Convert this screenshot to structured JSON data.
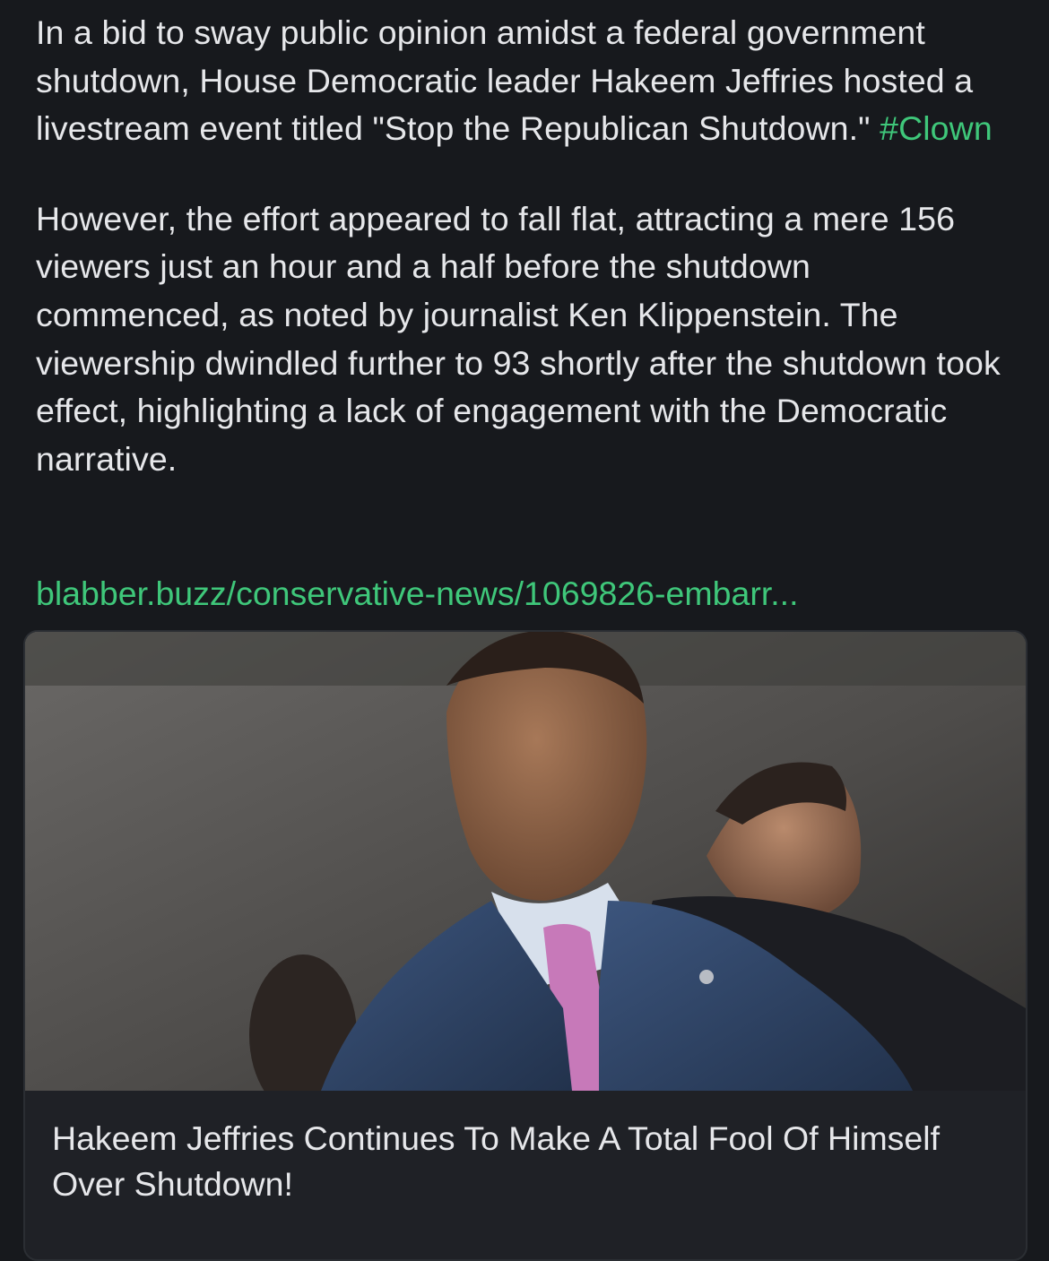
{
  "post": {
    "paragraph1": "In a bid to sway public opinion amidst a federal government shutdown, House Democratic leader Hakeem Jeffries hosted a livestream event titled \"Stop the Republican Shutdown.\"",
    "hashtag": "#Clown",
    "paragraph2": "However, the effort appeared to fall flat, attracting a mere 156 viewers just an hour and a half before the shutdown commenced, as noted by journalist Ken Klippenstein. The viewership dwindled further to 93 shortly after the shutdown took effect, highlighting a lack of engagement with the Democratic narrative.",
    "link_text": "blabber.buzz/conservative-news/1069826-embarr..."
  },
  "link_card": {
    "title": "Hakeem Jeffries Continues To Make A Total Fool Of Himself Over Shutdown!"
  },
  "colors": {
    "background": "#17191d",
    "text": "#e6e7ea",
    "accent": "#3fc77a",
    "card_background": "#1f2126",
    "card_border": "#2b2e33"
  }
}
